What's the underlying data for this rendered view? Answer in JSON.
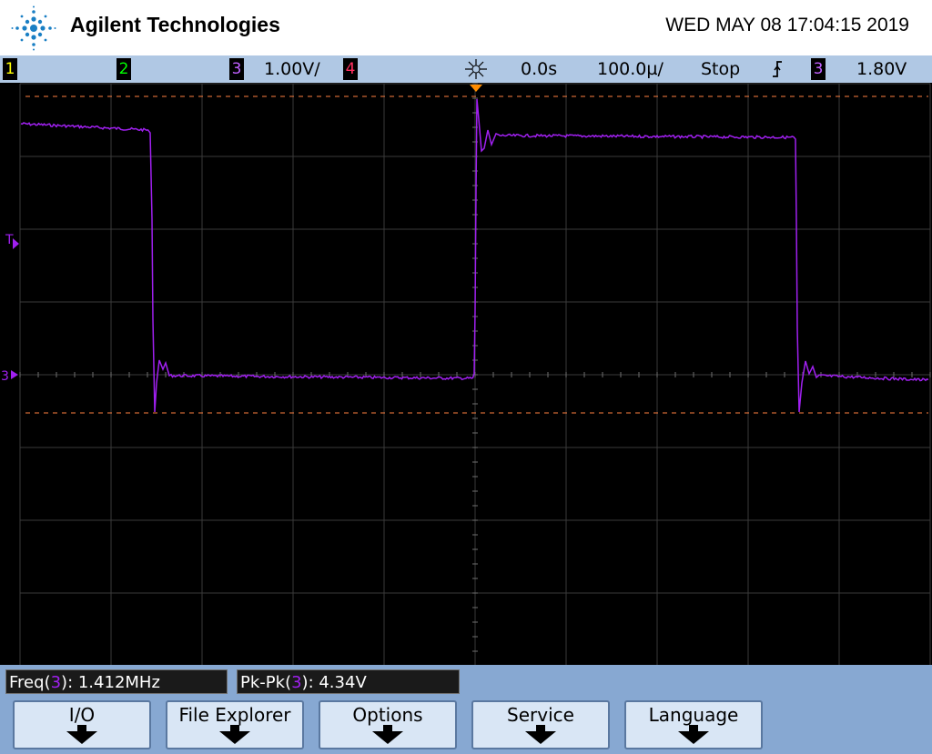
{
  "header": {
    "brand": "Agilent Technologies",
    "datetime": "WED MAY 08 17:04:15 2019",
    "logo_icon": "spark-logo-icon"
  },
  "status": {
    "channels": [
      {
        "num": "1",
        "color": "#ffff00"
      },
      {
        "num": "2",
        "color": "#00ff00"
      },
      {
        "num": "3",
        "color": "#b040ff"
      },
      {
        "num": "4",
        "color": "#ff3060"
      }
    ],
    "ch3_scale": "1.00V/",
    "trigger_pos_icon": "trigger-position-icon",
    "time_delay": "0.0s",
    "time_base": "100.0µ/",
    "run_state": "Stop",
    "trigger_edge_icon": "rising-edge-icon",
    "trigger_channel": "3",
    "trigger_level": "1.80V"
  },
  "screen": {
    "trigger_marker": "T",
    "ch3_ground_marker": "3",
    "trace_color": "#a020f0",
    "cursor_color": "#ff8040"
  },
  "measurements": [
    {
      "name": "Freq",
      "channel": "3",
      "value": "1.412MHz"
    },
    {
      "name": "Pk-Pk",
      "channel": "3",
      "value": "4.34V"
    }
  ],
  "softkeys": [
    {
      "label": "I/O"
    },
    {
      "label": "File Explorer"
    },
    {
      "label": "Options"
    },
    {
      "label": "Service"
    },
    {
      "label": "Language"
    }
  ]
}
